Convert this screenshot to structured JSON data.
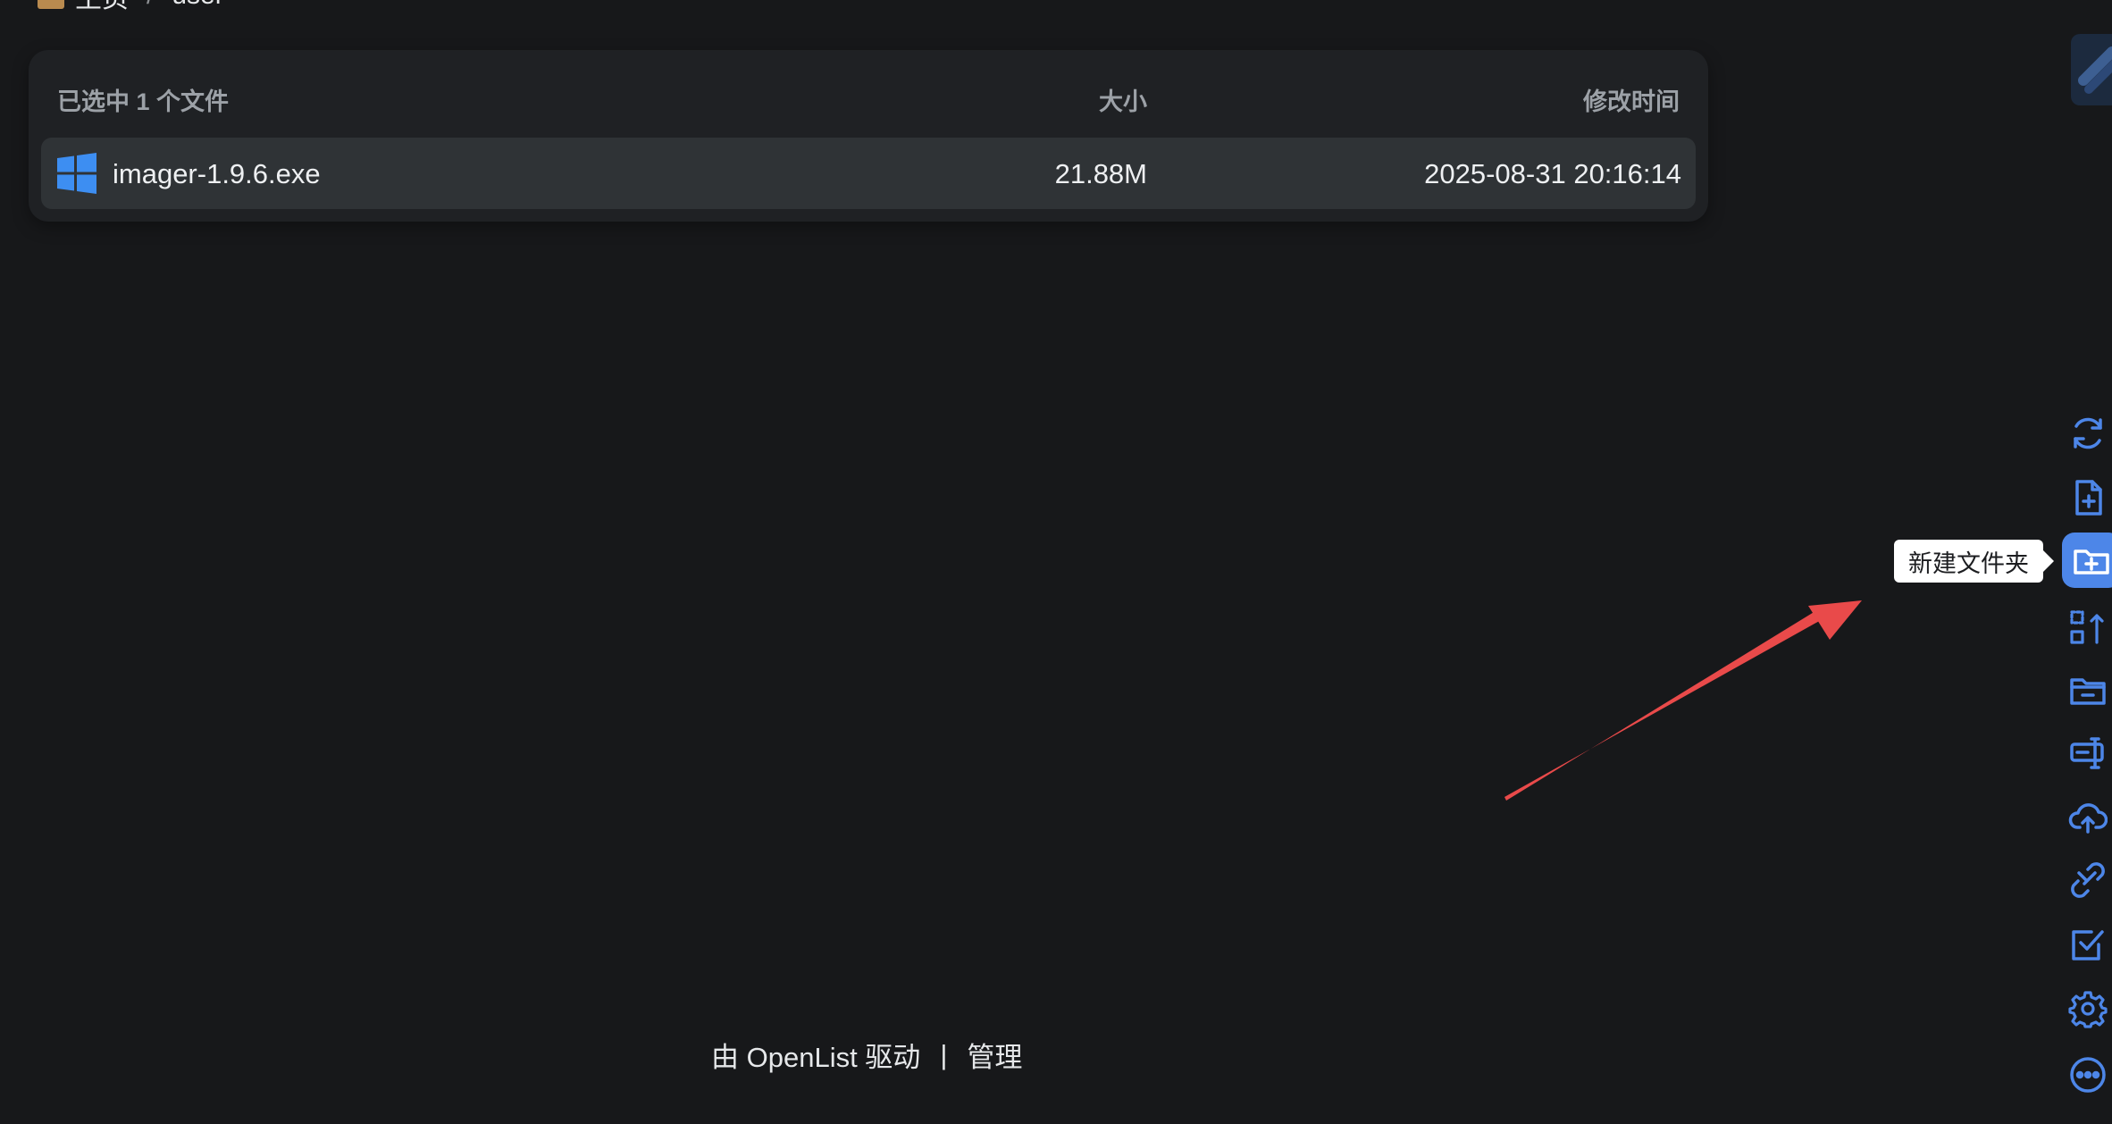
{
  "breadcrumb": {
    "home_label": "主页",
    "separator": "/",
    "current": "user"
  },
  "file_list": {
    "header": {
      "selection_label": "已选中 1 个文件",
      "size_label": "大小",
      "mtime_label": "修改时间"
    },
    "rows": [
      {
        "icon": "windows-icon",
        "name": "imager-1.9.6.exe",
        "size": "21.88M",
        "modified": "2025-08-31 20:16:14"
      }
    ]
  },
  "footer": {
    "powered_by": "由 OpenList 驱动",
    "separator": "|",
    "admin_link": "管理"
  },
  "toolbar": {
    "items": [
      {
        "icon": "refresh-icon"
      },
      {
        "icon": "new-file-icon"
      },
      {
        "icon": "new-folder-icon",
        "active": true
      },
      {
        "icon": "move-icon"
      },
      {
        "icon": "folder-minus-icon"
      },
      {
        "icon": "rename-icon"
      },
      {
        "icon": "upload-cloud-icon"
      },
      {
        "icon": "link-icon"
      },
      {
        "icon": "checkbox-icon"
      },
      {
        "icon": "gear-icon"
      },
      {
        "icon": "more-icon"
      }
    ]
  },
  "tooltip": {
    "text": "新建文件夹"
  },
  "colors": {
    "background": "#17181a",
    "card": "#1f2124",
    "row_selected": "#2f3336",
    "accent": "#4d86e8",
    "annotation": "#e94a4a"
  }
}
